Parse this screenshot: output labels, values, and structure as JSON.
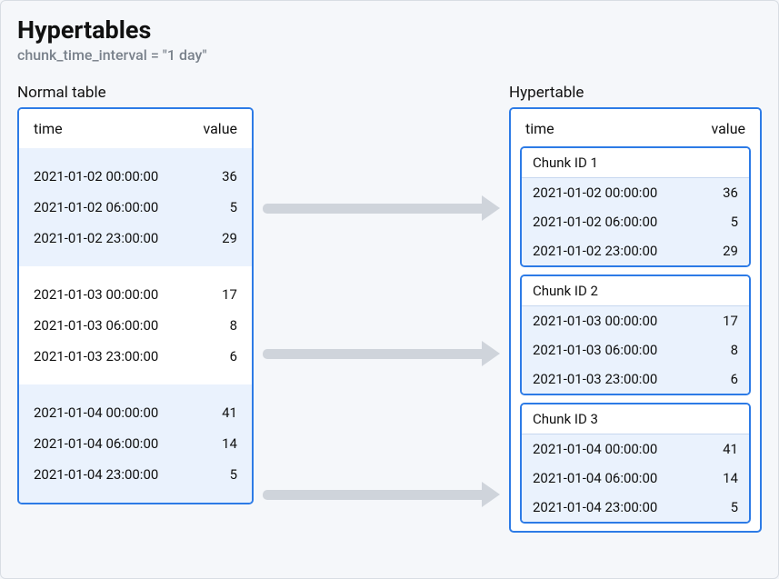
{
  "title": "Hypertables",
  "subtitle": "chunk_time_interval = \"1 day\"",
  "left": {
    "label": "Normal table",
    "columns": {
      "time": "time",
      "value": "value"
    },
    "groups": [
      {
        "rows": [
          {
            "time": "2021-01-02 00:00:00",
            "value": "36"
          },
          {
            "time": "2021-01-02 06:00:00",
            "value": "5"
          },
          {
            "time": "2021-01-02 23:00:00",
            "value": "29"
          }
        ],
        "shaded": true
      },
      {
        "rows": [
          {
            "time": "2021-01-03 00:00:00",
            "value": "17"
          },
          {
            "time": "2021-01-03 06:00:00",
            "value": "8"
          },
          {
            "time": "2021-01-03 23:00:00",
            "value": "6"
          }
        ],
        "shaded": false
      },
      {
        "rows": [
          {
            "time": "2021-01-04 00:00:00",
            "value": "41"
          },
          {
            "time": "2021-01-04 06:00:00",
            "value": "14"
          },
          {
            "time": "2021-01-04 23:00:00",
            "value": "5"
          }
        ],
        "shaded": true
      }
    ]
  },
  "right": {
    "label": "Hypertable",
    "columns": {
      "time": "time",
      "value": "value"
    },
    "chunks": [
      {
        "header": "Chunk ID 1",
        "rows": [
          {
            "time": "2021-01-02 00:00:00",
            "value": "36"
          },
          {
            "time": "2021-01-02 06:00:00",
            "value": "5"
          },
          {
            "time": "2021-01-02 23:00:00",
            "value": "29"
          }
        ]
      },
      {
        "header": "Chunk ID 2",
        "rows": [
          {
            "time": "2021-01-03 00:00:00",
            "value": "17"
          },
          {
            "time": "2021-01-03 06:00:00",
            "value": "8"
          },
          {
            "time": "2021-01-03 23:00:00",
            "value": "6"
          }
        ]
      },
      {
        "header": "Chunk ID 3",
        "rows": [
          {
            "time": "2021-01-04 00:00:00",
            "value": "41"
          },
          {
            "time": "2021-01-04 06:00:00",
            "value": "14"
          },
          {
            "time": "2021-01-04 23:00:00",
            "value": "5"
          }
        ]
      }
    ]
  },
  "colors": {
    "panel_border": "#2d7be6",
    "shaded_bg": "#eaf2fd",
    "arrow": "#cfd4db",
    "page_bg": "#f5f7fa"
  }
}
